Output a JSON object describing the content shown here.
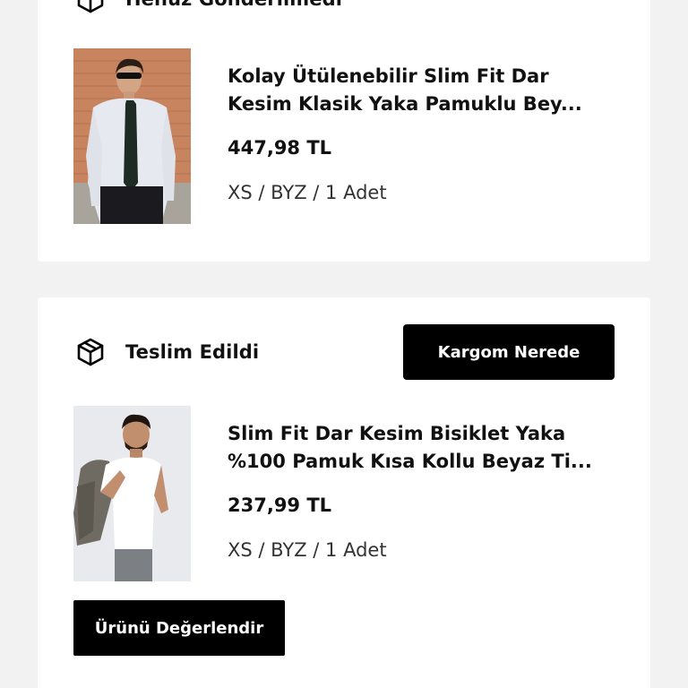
{
  "orders": [
    {
      "status_label": "Henüz Gönderilmedi",
      "status_icon": "package-icon",
      "product": {
        "title_line1": "Kolay Ütülenebilir Slim Fit Dar",
        "title_line2": "Kesim Klasik Yaka Pamuklu Bey...",
        "price": "447,98 TL",
        "variant": "XS / BYZ / 1 Adet",
        "image_alt": "Beyaz gömlek ve koyu kravatlı erkek model"
      }
    },
    {
      "status_label": "Teslim Edildi",
      "status_icon": "package-icon",
      "track_button_label": "Kargom Nerede",
      "product": {
        "title_line1": "Slim Fit Dar Kesim Bisiklet Yaka",
        "title_line2": "%100 Pamuk Kısa Kollu Beyaz Ti...",
        "price": "237,99 TL",
        "variant": "XS / BYZ / 1 Adet",
        "image_alt": "Beyaz tişörtlü erkek model"
      },
      "review_button_label": "Ürünü Değerlendir"
    }
  ]
}
